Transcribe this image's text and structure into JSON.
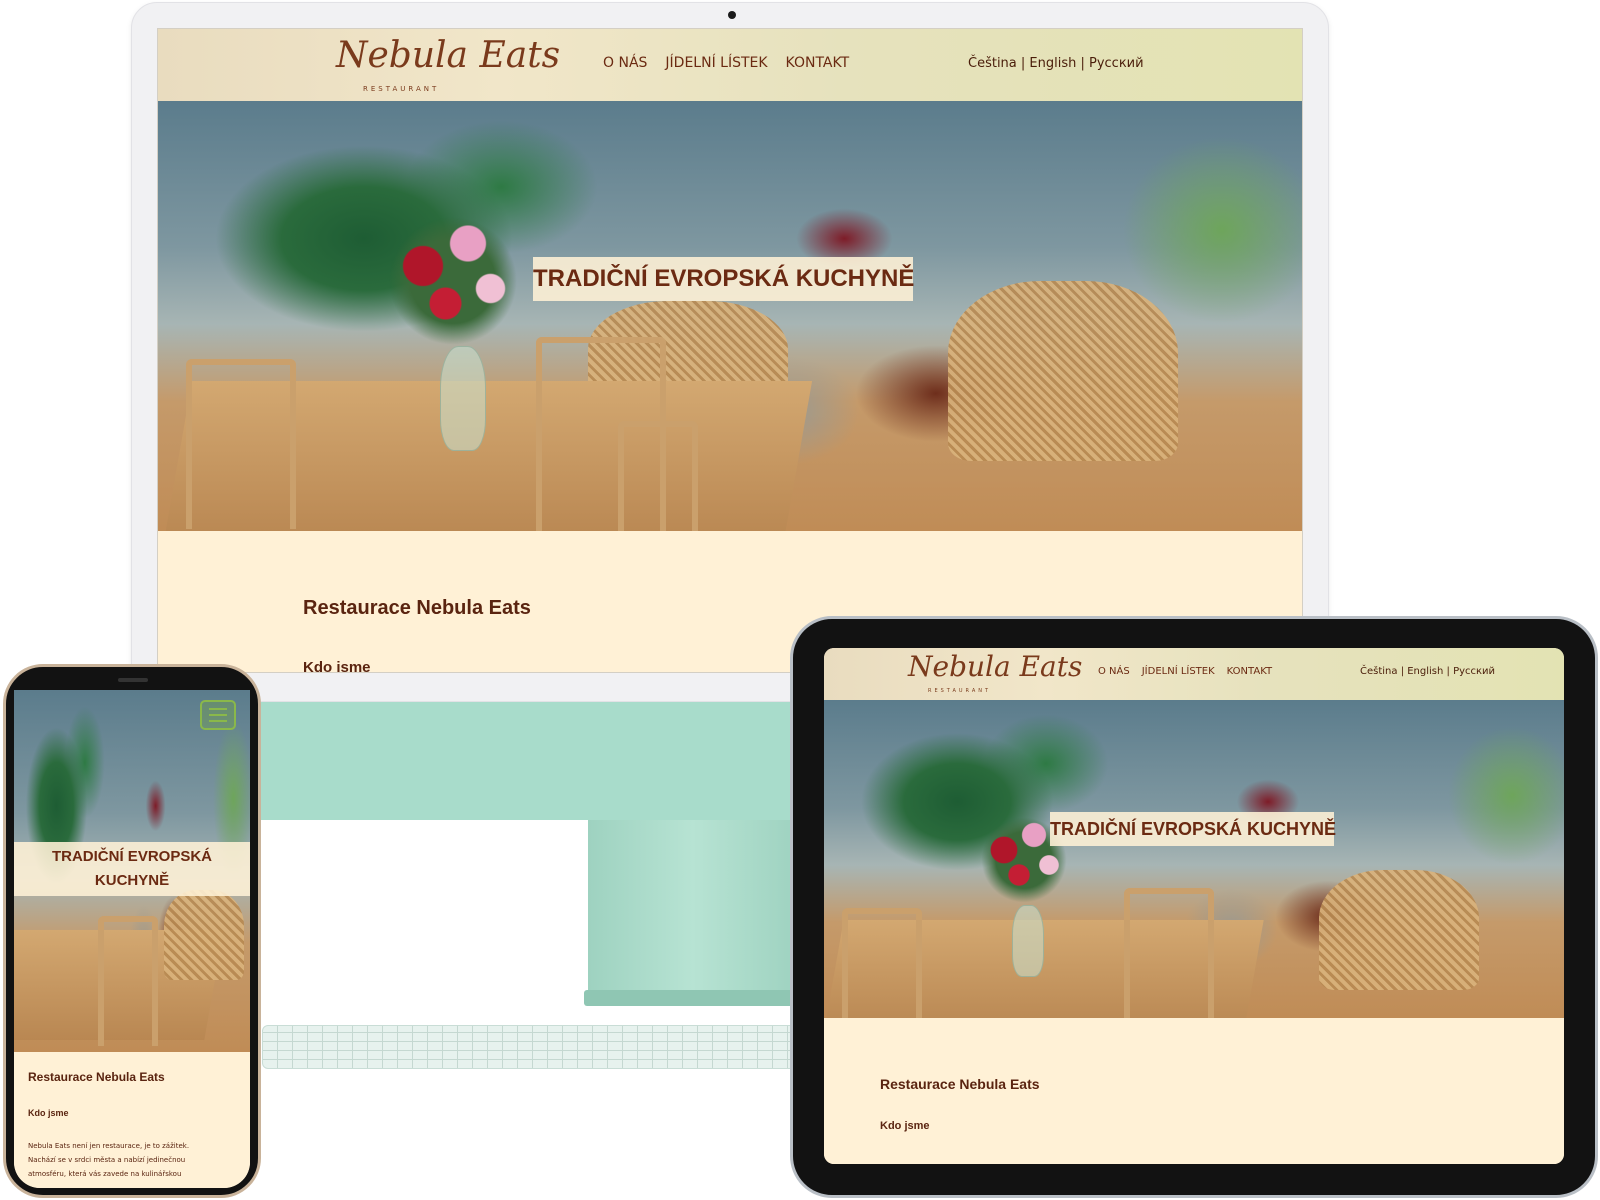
{
  "site": {
    "logo": "Nebula Eats",
    "logo_tagline": "RESTAURANT",
    "nav": [
      "O NÁS",
      "JÍDELNÍ LÍSTEK",
      "KONTAKT"
    ],
    "languages": "Čeština | English | Русский",
    "hero_title": "TRADIČNÍ EVROPSKÁ KUCHYNĚ",
    "hero_title_mobile_line1": "TRADIČNÍ EVROPSKÁ",
    "hero_title_mobile_line2": "KUCHYNĚ",
    "heading": "Restaurace Nebula Eats",
    "subheading": "Kdo jsme",
    "paragraph_line1": "Nebula Eats není jen restaurace, je to zážitek.",
    "paragraph_line2": "Nachází se v srdci města a nabízí jedinečnou",
    "paragraph_line3": "atmosféru, která vás zavede na kulinářskou"
  },
  "colors": {
    "accent_text": "#6b2a12",
    "content_background": "#fff1d6",
    "imac_body": "#a8dccb"
  },
  "icons": {
    "menu": "hamburger-menu-icon",
    "camera": "camera-icon"
  }
}
